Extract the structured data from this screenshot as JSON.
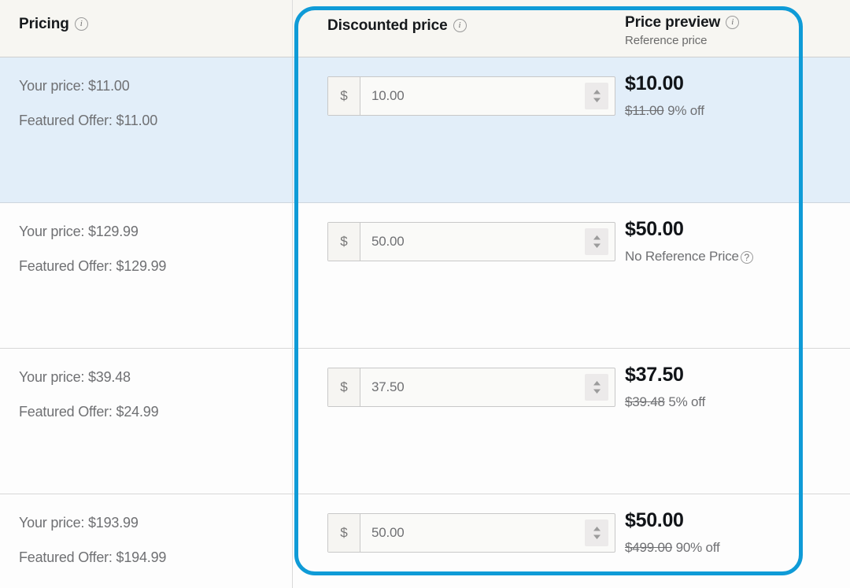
{
  "header": {
    "pricing": {
      "title": "Pricing",
      "icon": "info-icon"
    },
    "discounted_price": {
      "title": "Discounted price",
      "icon": "info-icon"
    },
    "price_preview": {
      "title": "Price preview",
      "subtitle": "Reference price",
      "icon": "info-icon"
    }
  },
  "input": {
    "currency_symbol": "$",
    "stepper_icon": "up-down-chevron-icon"
  },
  "annotation": {
    "color": "#0f9bd7",
    "shape": "rounded-rectangle"
  },
  "colors": {
    "highlight_row": "#e2eef9",
    "header_bg": "#f7f6f2",
    "accent": "#0f9bd7",
    "muted_text": "#6f7073",
    "title_text": "#16191c"
  },
  "rows": [
    {
      "highlighted": true,
      "your_price": "Your price: $11.00",
      "featured_offer": "Featured Offer: $11.00",
      "discount_value": "10.00",
      "preview_price": "$10.00",
      "reference_price": "$11.00",
      "discount_text": "9% off",
      "has_reference": true
    },
    {
      "highlighted": false,
      "your_price": "Your price: $129.99",
      "featured_offer": "Featured Offer: $129.99",
      "discount_value": "50.00",
      "preview_price": "$50.00",
      "reference_price": "",
      "discount_text": "",
      "no_reference_text": "No Reference Price",
      "has_reference": false
    },
    {
      "highlighted": false,
      "your_price": "Your price: $39.48",
      "featured_offer": "Featured Offer: $24.99",
      "discount_value": "37.50",
      "preview_price": "$37.50",
      "reference_price": "$39.48",
      "discount_text": "5% off",
      "has_reference": true
    },
    {
      "highlighted": false,
      "your_price": "Your price: $193.99",
      "featured_offer": "Featured Offer: $194.99",
      "discount_value": "50.00",
      "preview_price": "$50.00",
      "reference_price": "$499.00",
      "discount_text": "90% off",
      "has_reference": true
    }
  ]
}
